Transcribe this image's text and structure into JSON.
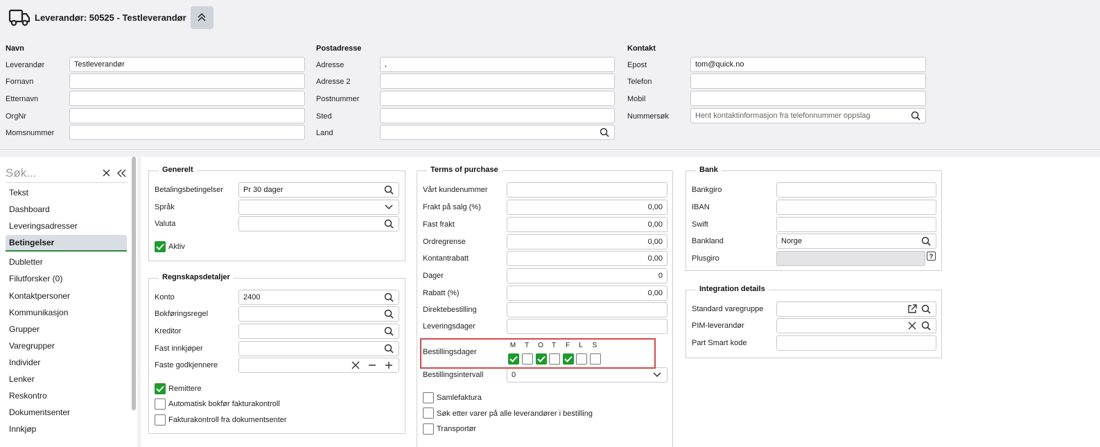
{
  "header": {
    "title": "Leverandør: 50525 - Testleverandør",
    "navn": {
      "title": "Navn",
      "fields": [
        {
          "label": "Leverandør",
          "value": "Testleverandør"
        },
        {
          "label": "Fornavn",
          "value": ""
        },
        {
          "label": "Etternavn",
          "value": ""
        },
        {
          "label": "OrgNr",
          "value": ""
        },
        {
          "label": "Momsnummer",
          "value": ""
        }
      ]
    },
    "postadresse": {
      "title": "Postadresse",
      "fields": [
        {
          "label": "Adresse",
          "value": ","
        },
        {
          "label": "Adresse 2",
          "value": ""
        },
        {
          "label": "Postnummer",
          "value": ""
        },
        {
          "label": "Sted",
          "value": ""
        },
        {
          "label": "Land",
          "value": ""
        }
      ]
    },
    "kontakt": {
      "title": "Kontakt",
      "fields": [
        {
          "label": "Epost",
          "value": "tom@quick.no"
        },
        {
          "label": "Telefon",
          "value": ""
        },
        {
          "label": "Mobil",
          "value": ""
        },
        {
          "label": "Nummersøk",
          "value": "",
          "placeholder": "Hent kontaktinformasjon fra telefonnummer oppslag"
        }
      ]
    }
  },
  "sidebar": {
    "search_placeholder": "Søk...",
    "items": [
      {
        "label": "Tekst"
      },
      {
        "label": "Dashboard"
      },
      {
        "label": "Leveringsadresser"
      },
      {
        "label": "Betingelser",
        "active": true
      },
      {
        "label": "Dubletter"
      },
      {
        "label": "Filutforsker (0)"
      },
      {
        "label": "Kontaktpersoner"
      },
      {
        "label": "Kommunikasjon"
      },
      {
        "label": "Grupper"
      },
      {
        "label": "Varegrupper"
      },
      {
        "label": "Individer"
      },
      {
        "label": "Lenker"
      },
      {
        "label": "Reskontro"
      },
      {
        "label": "Dokumentsenter"
      },
      {
        "label": "Innkjøp"
      }
    ]
  },
  "generelt": {
    "title": "Generelt",
    "betalingsbetingelser": {
      "label": "Betalingsbetingelser",
      "value": "Pr 30 dager"
    },
    "sprak": {
      "label": "Språk",
      "value": ""
    },
    "valuta": {
      "label": "Valuta",
      "value": ""
    },
    "aktiv": {
      "label": "Aktiv",
      "checked": true
    }
  },
  "regnskap": {
    "title": "Regnskapsdetaljer",
    "konto": {
      "label": "Konto",
      "value": "2400"
    },
    "bokforingsregel": {
      "label": "Bokføringsregel",
      "value": ""
    },
    "kreditor": {
      "label": "Kreditor",
      "value": ""
    },
    "fast_innkjoper": {
      "label": "Fast innkjøper",
      "value": ""
    },
    "faste_godkjennere": {
      "label": "Faste godkjennere",
      "value": ""
    },
    "remittere": {
      "label": "Remittere",
      "checked": true
    },
    "auto_bokfor": {
      "label": "Automatisk bokfør fakturakontroll",
      "checked": false
    },
    "fakturakontroll": {
      "label": "Fakturakontroll fra dokumentsenter",
      "checked": false
    }
  },
  "terms": {
    "title": "Terms of purchase",
    "fields": [
      {
        "label": "Vårt kundenummer",
        "value": ""
      },
      {
        "label": "Frakt på salg (%)",
        "value": "0,00"
      },
      {
        "label": "Fast frakt",
        "value": "0,00"
      },
      {
        "label": "Ordregrense",
        "value": "0,00"
      },
      {
        "label": "Kontantrabatt",
        "value": "0,00"
      },
      {
        "label": "Dager",
        "value": "0"
      },
      {
        "label": "Rabatt (%)",
        "value": "0,00"
      },
      {
        "label": "Direktebestilling",
        "value": ""
      },
      {
        "label": "Leveringsdager",
        "value": ""
      }
    ],
    "bestillingsdager": {
      "label": "Bestillingsdager",
      "days": [
        {
          "letter": "M",
          "checked": true
        },
        {
          "letter": "T",
          "checked": false
        },
        {
          "letter": "O",
          "checked": true
        },
        {
          "letter": "T",
          "checked": false
        },
        {
          "letter": "F",
          "checked": true
        },
        {
          "letter": "L",
          "checked": false
        },
        {
          "letter": "S",
          "checked": false
        }
      ]
    },
    "bestillingsintervall": {
      "label": "Bestillingsintervall",
      "value": "0"
    },
    "samlefaktura": {
      "label": "Samlefaktura",
      "checked": false
    },
    "sok_varer": {
      "label": "Søk etter varer på alle leverandører i bestilling",
      "checked": false
    },
    "transportor": {
      "label": "Transportør",
      "checked": false
    }
  },
  "bank": {
    "title": "Bank",
    "fields": [
      {
        "label": "Bankgiro",
        "value": ""
      },
      {
        "label": "IBAN",
        "value": ""
      },
      {
        "label": "Swift",
        "value": ""
      },
      {
        "label": "Bankland",
        "value": "Norge"
      },
      {
        "label": "Plusgiro",
        "value": ""
      }
    ]
  },
  "integration": {
    "title": "Integration details",
    "fields": [
      {
        "label": "Standard varegruppe",
        "value": ""
      },
      {
        "label": "PIM-leverandør",
        "value": ""
      },
      {
        "label": "Part Smart kode",
        "value": ""
      }
    ]
  },
  "colors": {
    "accent_green": "#1f9a2e",
    "highlight_red": "#d04a4a"
  }
}
